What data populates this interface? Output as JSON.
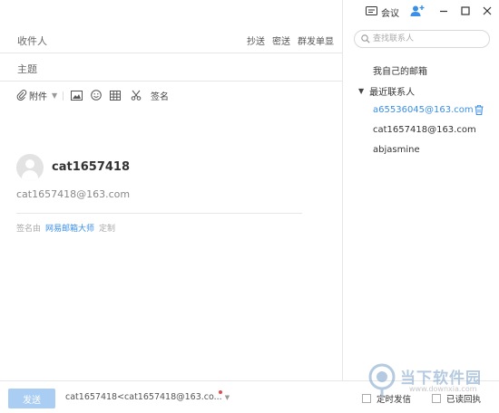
{
  "compose": {
    "to_label": "收件人",
    "cc_label": "抄送",
    "bcc_label": "密送",
    "group_single_label": "群发单显",
    "subject_label": "主题"
  },
  "toolbar": {
    "attach_label": "附件",
    "signature_label": "签名",
    "icons": [
      "attach-icon",
      "image-icon",
      "emoji-icon",
      "table-icon",
      "screenshot-icon"
    ]
  },
  "signature": {
    "name": "cat1657418",
    "email": "cat1657418@163.com",
    "footer_prefix": "签名由",
    "footer_brand": "网易邮箱大师",
    "footer_custom": "定制"
  },
  "window": {
    "meeting_label": "会议"
  },
  "contacts": {
    "search_placeholder": "查找联系人",
    "my_mailbox": "我自己的邮箱",
    "recent_group": "最近联系人",
    "recent": [
      "a65536045@163.com",
      "cat1657418@163.com",
      "abjasmine"
    ]
  },
  "bottom": {
    "send_label": "发送",
    "from": "cat1657418<cat1657418@163.co...",
    "timed_label": "定时发信",
    "receipt_label": "已读回执"
  },
  "watermark": {
    "text": "当下软件园",
    "url": "www.downxia.com"
  },
  "colors": {
    "accent": "#3b8fe6",
    "send_button": "#a9cdf3",
    "border": "#e6e6e6"
  }
}
